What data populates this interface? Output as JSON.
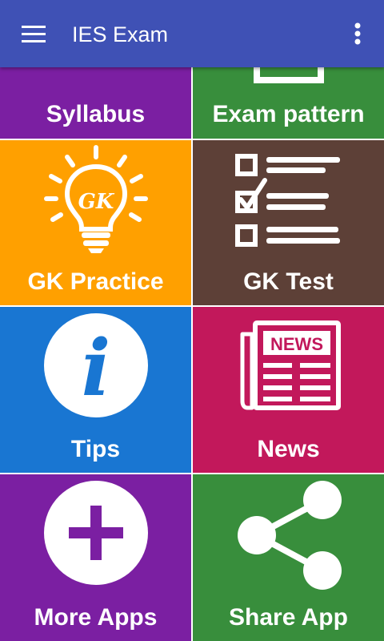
{
  "app_bar": {
    "title": "IES Exam",
    "menu_icon": "hamburger-menu-icon",
    "overflow_icon": "more-vert-icon",
    "color": "#3f51b5"
  },
  "tiles": [
    {
      "label": "Syllabus",
      "color": "#7b1fa2",
      "icon": "syllabus-icon"
    },
    {
      "label": "Exam pattern",
      "color": "#388e3c",
      "icon": "exam-pattern-icon"
    },
    {
      "label": "GK Practice",
      "color": "#ffa000",
      "icon": "lightbulb-gk-icon",
      "icon_text": "GK"
    },
    {
      "label": "GK Test",
      "color": "#5d4037",
      "icon": "checklist-icon"
    },
    {
      "label": "Tips",
      "color": "#1976d2",
      "icon": "info-icon",
      "icon_text": "i"
    },
    {
      "label": "News",
      "color": "#c2185b",
      "icon": "newspaper-icon",
      "icon_text": "NEWS"
    },
    {
      "label": "More Apps",
      "color": "#7b1fa2",
      "icon": "plus-icon"
    },
    {
      "label": "Share App",
      "color": "#388e3c",
      "icon": "share-icon"
    }
  ]
}
